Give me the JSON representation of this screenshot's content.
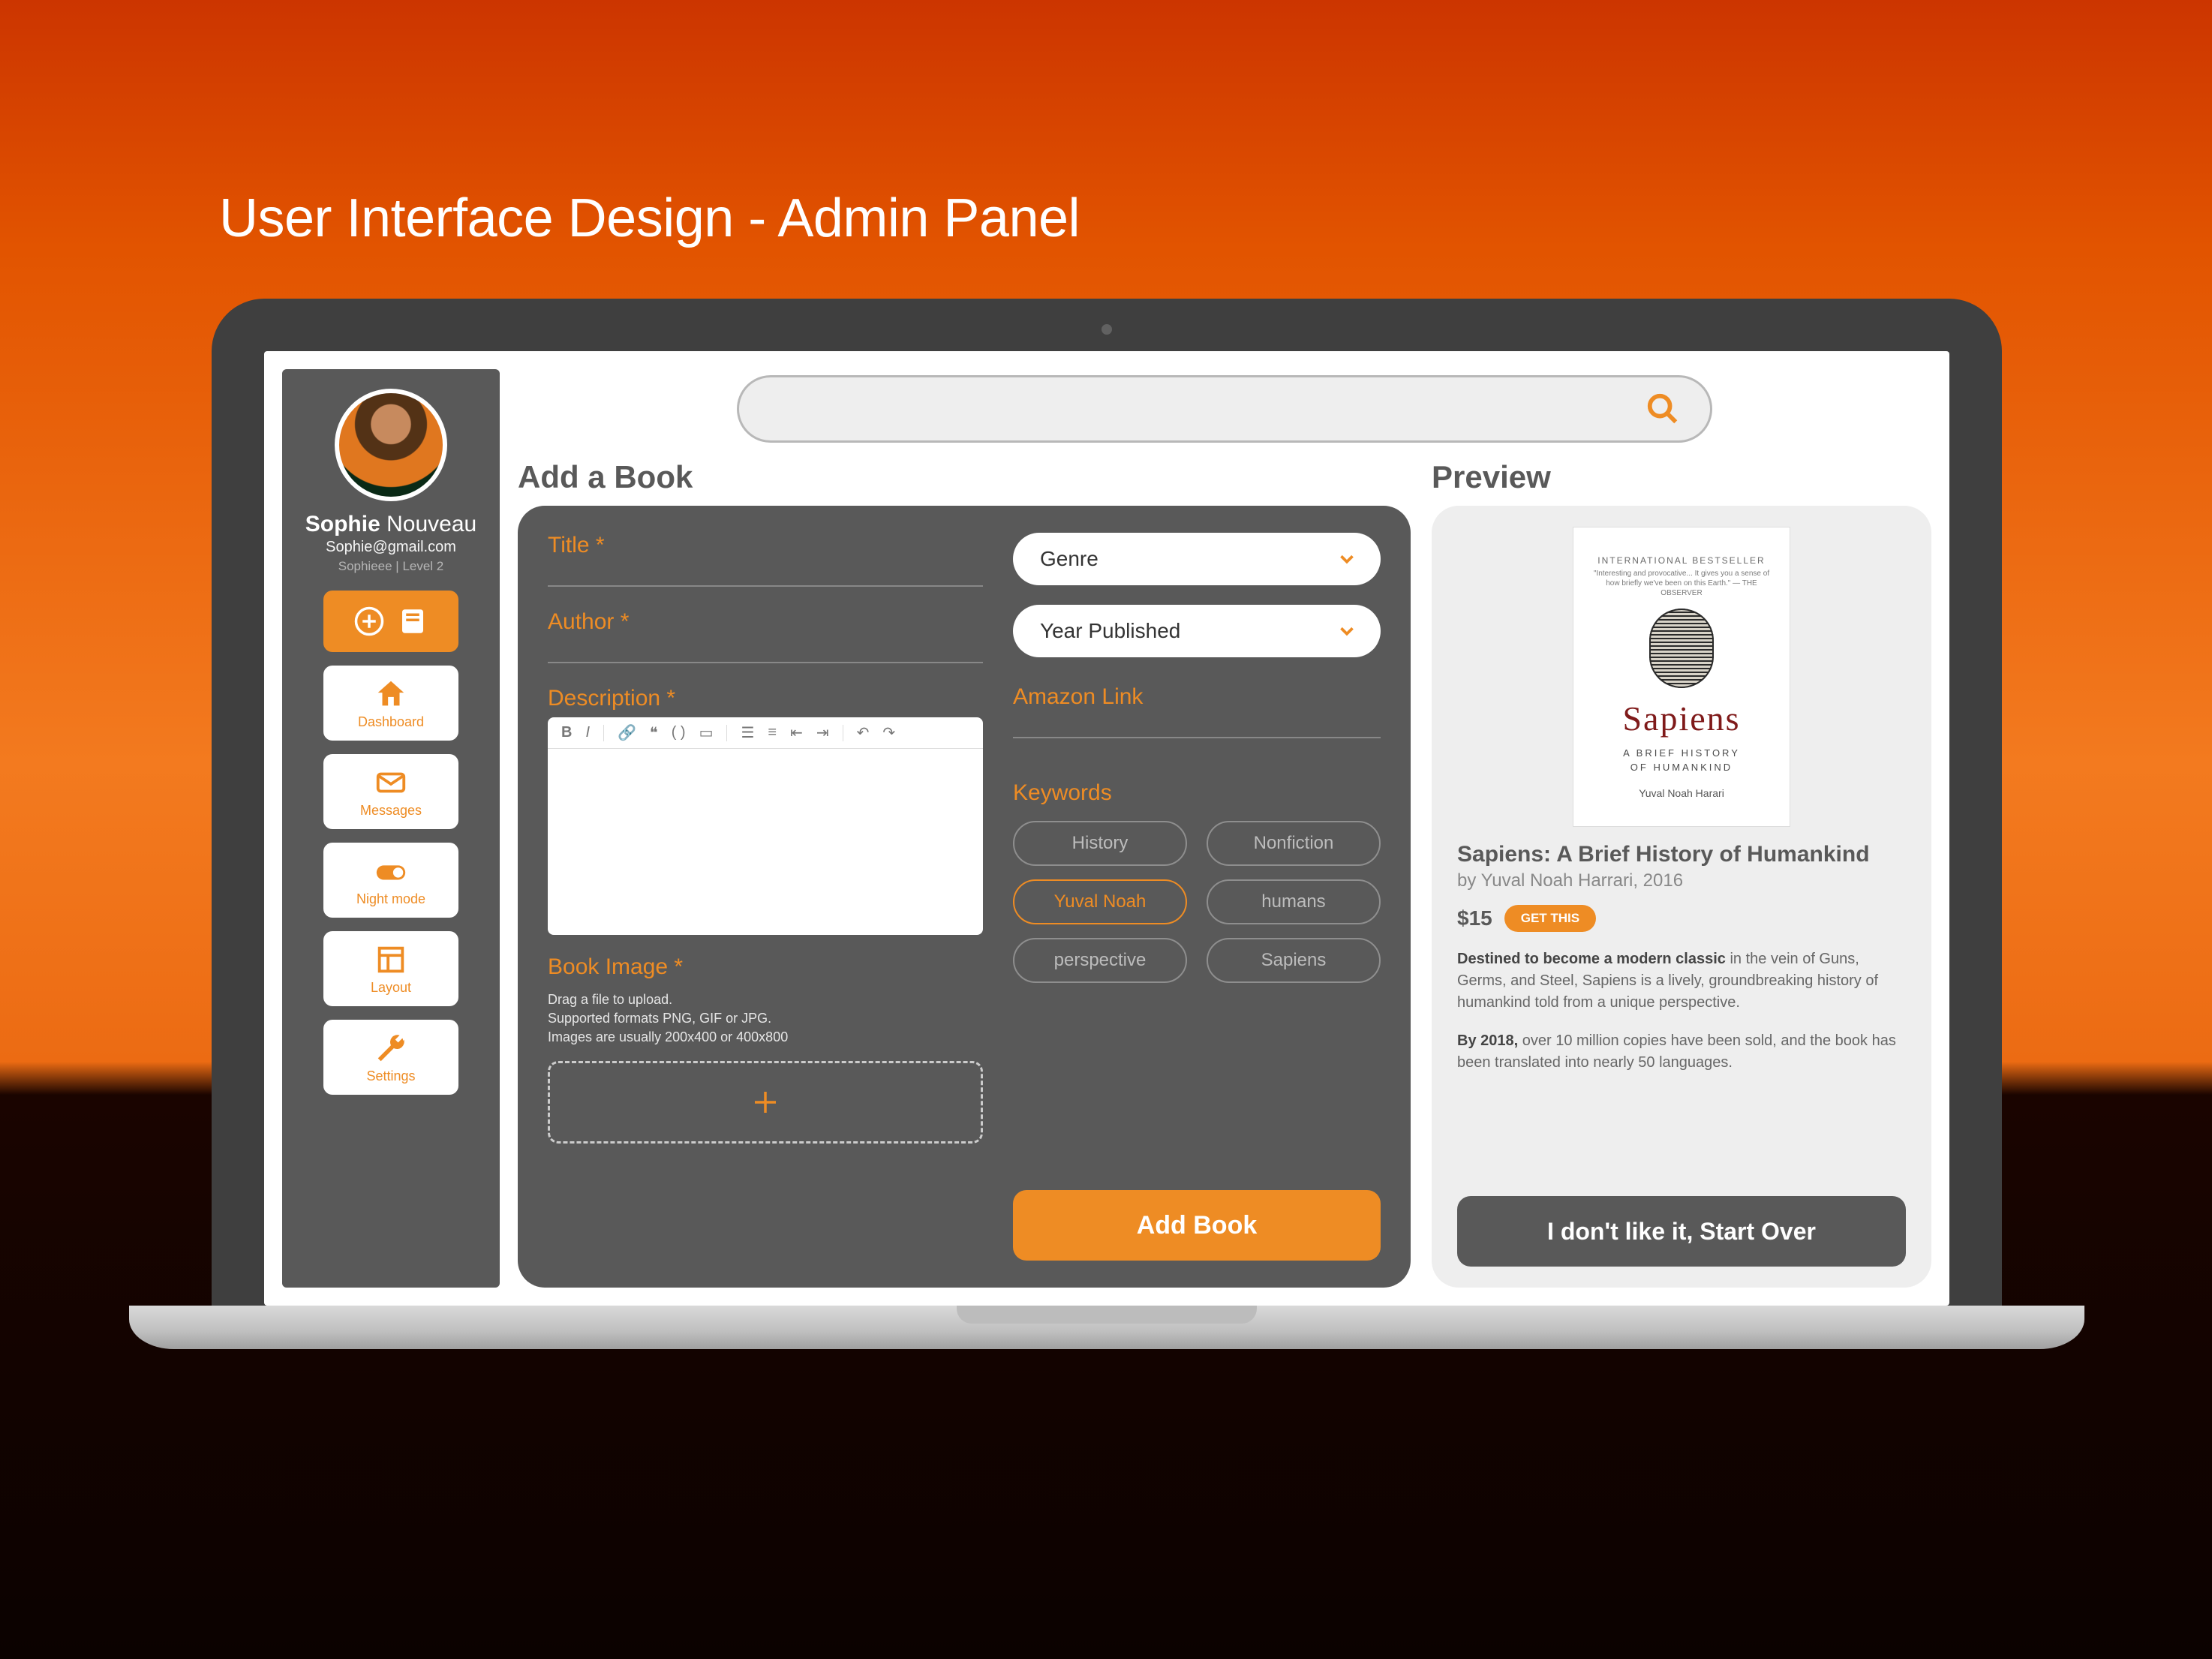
{
  "page_heading": "User Interface Design - Admin Panel",
  "user": {
    "first_name": "Sophie",
    "last_name": "Nouveau",
    "email": "Sophie@gmail.com",
    "meta": "Sophieee | Level 2"
  },
  "nav": {
    "dashboard": "Dashboard",
    "messages": "Messages",
    "night_mode": "Night mode",
    "layout": "Layout",
    "settings": "Settings"
  },
  "main": {
    "add_title": "Add a Book",
    "preview_title": "Preview",
    "fields": {
      "title": "Title *",
      "author": "Author *",
      "description": "Description *",
      "book_image": "Book Image *",
      "upload_hint_1": "Drag a file to upload.",
      "upload_hint_2": "Supported formats PNG, GIF or JPG.",
      "upload_hint_3": "Images are usually 200x400 or 400x800",
      "genre": "Genre",
      "year": "Year Published",
      "amazon": "Amazon Link",
      "keywords_label": "Keywords"
    },
    "keywords": [
      "History",
      "Nonfiction",
      "Yuval Noah",
      "humans",
      "perspective",
      "Sapiens"
    ],
    "keyword_active_index": 2,
    "add_button": "Add Book"
  },
  "preview": {
    "cover": {
      "banner": "INTERNATIONAL BESTSELLER",
      "quote": "\"Interesting and provocative... It gives you a sense of how briefly we've been on this Earth.\" — THE OBSERVER",
      "title": "Sapiens",
      "subtitle_1": "A BRIEF HISTORY",
      "subtitle_2": "OF HUMANKIND",
      "author": "Yuval Noah Harari"
    },
    "title": "Sapiens: A Brief History of Humankind",
    "byline": "by Yuval Noah Harrari, 2016",
    "price": "$15",
    "cta": "GET THIS",
    "blurb_1_bold": "Destined to become a modern classic",
    "blurb_1_rest": " in the vein of Guns, Germs, and Steel, Sapiens is a lively, groundbreaking history of humankind told from a unique perspective.",
    "blurb_2_bold": "By 2018,",
    "blurb_2_rest": " over 10 million copies have been sold, and the book has been translated into nearly 50 languages.",
    "start_over": "I don't like it, Start Over"
  }
}
